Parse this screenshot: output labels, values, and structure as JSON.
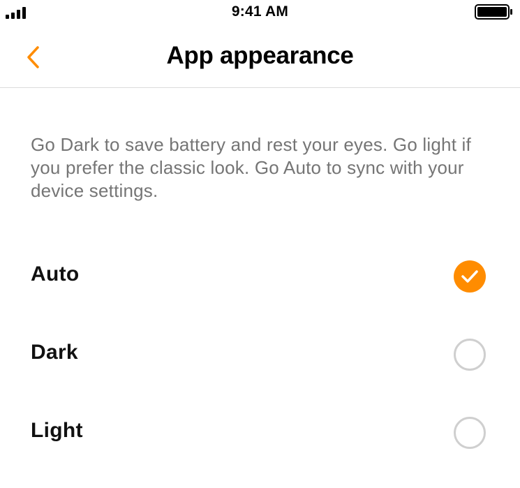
{
  "status_bar": {
    "time": "9:41 AM",
    "signal_icon": "cellular-signal-icon",
    "battery_icon": "battery-full-icon"
  },
  "nav": {
    "title": "App appearance",
    "back_icon": "chevron-left-icon"
  },
  "description": "Go Dark to save battery and rest your eyes. Go light if you prefer the classic look. Go Auto to sync with your device settings.",
  "options": [
    {
      "label": "Auto",
      "selected": true
    },
    {
      "label": "Dark",
      "selected": false
    },
    {
      "label": "Light",
      "selected": false
    }
  ],
  "colors": {
    "accent": "#FF8C00",
    "description_text": "#757575",
    "radio_border": "#CFCFCF",
    "divider": "#DCDCDC"
  }
}
